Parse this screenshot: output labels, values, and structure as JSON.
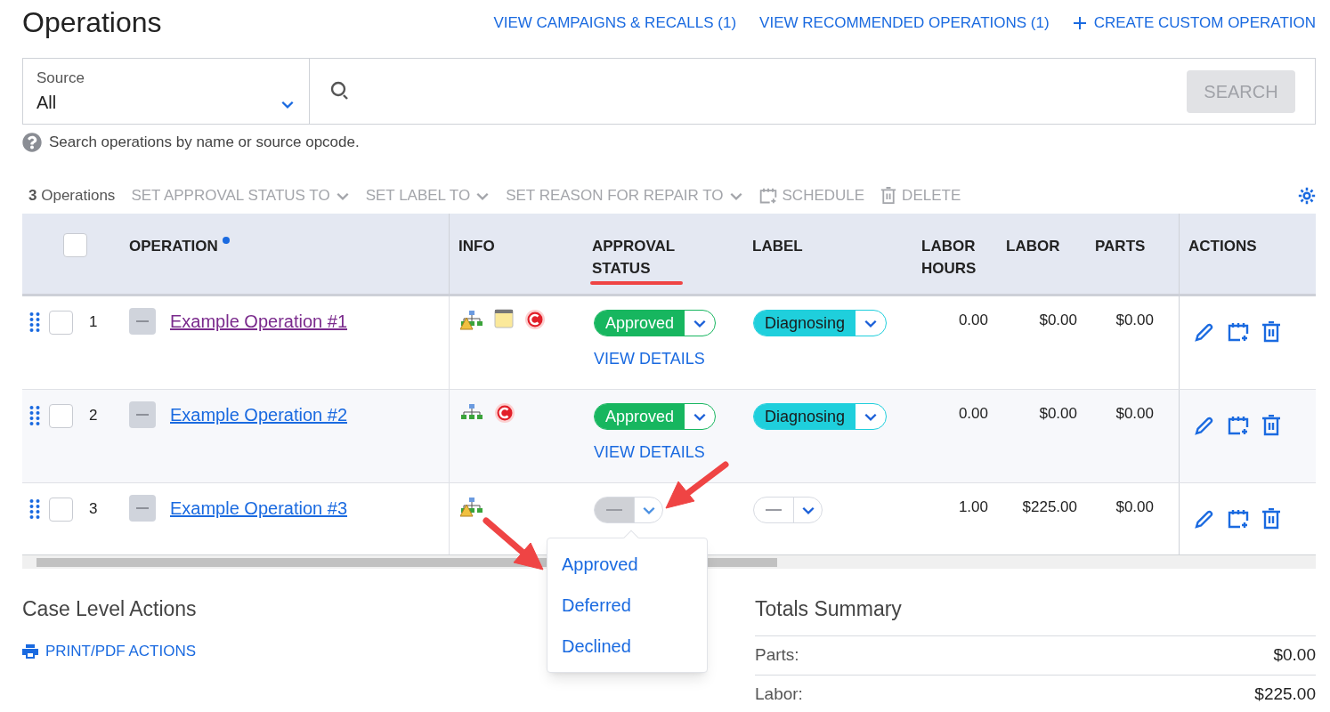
{
  "title": "Operations",
  "header_links": [
    {
      "label": "VIEW CAMPAIGNS & RECALLS (1)",
      "kind": "plain"
    },
    {
      "label": "VIEW RECOMMENDED OPERATIONS (1)",
      "kind": "plain"
    },
    {
      "label": "CREATE CUSTOM OPERATION",
      "kind": "create"
    }
  ],
  "source": {
    "label": "Source",
    "value": "All"
  },
  "search_button": {
    "label": "SEARCH",
    "disabled": true
  },
  "help_text": "Search operations by name or source opcode.",
  "toolbar": {
    "count": "3",
    "count_label": "Operations",
    "actions": [
      {
        "label": "SET APPROVAL STATUS TO",
        "kind": "dropdown"
      },
      {
        "label": "SET LABEL TO",
        "kind": "dropdown"
      },
      {
        "label": "SET REASON FOR REPAIR TO",
        "kind": "dropdown"
      },
      {
        "label": "SCHEDULE",
        "kind": "schedule"
      },
      {
        "label": "DELETE",
        "kind": "delete"
      }
    ]
  },
  "table": {
    "select_all": {
      "checked": false
    },
    "columns": [
      "OPERATION",
      "INFO",
      "APPROVAL STATUS",
      "LABEL",
      "LABOR HOURS",
      "LABOR",
      "PARTS",
      "ACTIONS"
    ],
    "rows": [
      {
        "number": "1",
        "name": "Example Operation #1",
        "visited": true,
        "checked": false,
        "info": [
          {
            "kind": "hierarchy-warning"
          },
          {
            "kind": "note"
          },
          {
            "kind": "c-badge"
          }
        ],
        "approval": {
          "value": "Approved",
          "kind": "approved"
        },
        "view_details": "VIEW DETAILS",
        "label": {
          "value": "Diagnosing",
          "kind": "diagnosing"
        },
        "labor_hours": "0.00",
        "labor": "$0.00",
        "parts": "$0.00"
      },
      {
        "number": "2",
        "name": "Example Operation #2",
        "visited": false,
        "checked": false,
        "info": [
          {
            "kind": "hierarchy"
          },
          {
            "kind": "c-badge"
          }
        ],
        "approval": {
          "value": "Approved",
          "kind": "approved"
        },
        "view_details": "VIEW DETAILS",
        "label": {
          "value": "Diagnosing",
          "kind": "diagnosing"
        },
        "labor_hours": "0.00",
        "labor": "$0.00",
        "parts": "$0.00"
      },
      {
        "number": "3",
        "name": "Example Operation #3",
        "visited": false,
        "checked": false,
        "info": [
          {
            "kind": "hierarchy-warning"
          }
        ],
        "approval": {
          "kind": "empty"
        },
        "label": {
          "kind": "empty"
        },
        "labor_hours": "1.00",
        "labor": "$225.00",
        "parts": "$0.00"
      }
    ]
  },
  "approval_menu": {
    "options": [
      "Approved",
      "Deferred",
      "Declined"
    ]
  },
  "case_level": {
    "title": "Case Level Actions",
    "print_link": "PRINT/PDF ACTIONS"
  },
  "totals": {
    "title": "Totals Summary",
    "rows": [
      {
        "label": "Parts:",
        "value": "$0.00"
      },
      {
        "label": "Labor:",
        "value": "$225.00"
      }
    ]
  }
}
